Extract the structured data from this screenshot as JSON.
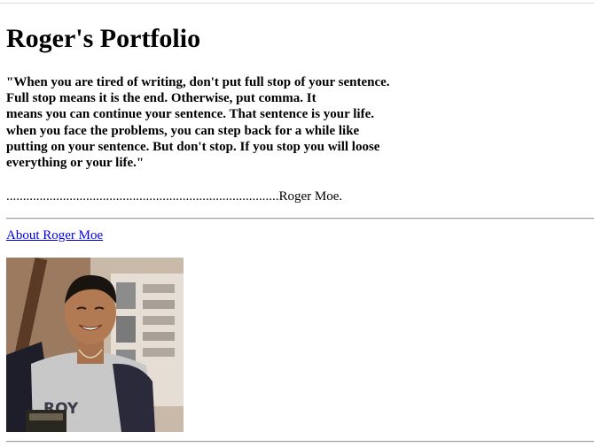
{
  "page": {
    "title": "Roger's Portfolio",
    "quote_lines": [
      "\"When you are tired of writing, don't put full stop of your sentence.",
      "Full stop means it is the end. Otherwise, put comma. It",
      "means you can continue your sentence. That sentence is your life.",
      "when you face the problems, you can step back for a while like",
      "putting on your sentence. But don't stop. If you stop you will loose",
      "everything or your life.\""
    ],
    "signature": "..................................................................................Roger Moe.",
    "about_link": "About Roger Moe",
    "photo": {
      "shirt_text": "ROY"
    }
  },
  "colors": {
    "link": "#0000ee",
    "rule": "#a0a0a0",
    "text": "#000000",
    "background": "#ffffff"
  }
}
